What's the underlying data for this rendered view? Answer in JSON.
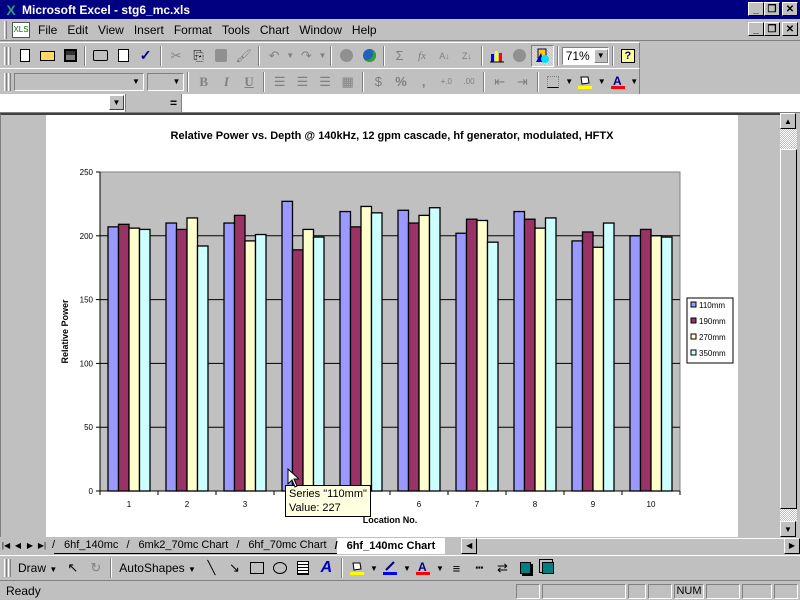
{
  "window": {
    "app_title": "Microsoft Excel - stg6_mc.xls",
    "controls": {
      "minimize": "_",
      "restore": "❐",
      "close": "✕"
    }
  },
  "menu": {
    "items": [
      {
        "label": "File",
        "accel": "F"
      },
      {
        "label": "Edit",
        "accel": "E"
      },
      {
        "label": "View",
        "accel": "V"
      },
      {
        "label": "Insert",
        "accel": "I"
      },
      {
        "label": "Format",
        "accel": "o"
      },
      {
        "label": "Tools",
        "accel": "T"
      },
      {
        "label": "Chart",
        "accel": "C"
      },
      {
        "label": "Window",
        "accel": "W"
      },
      {
        "label": "Help",
        "accel": "H"
      }
    ]
  },
  "standard_toolbar": {
    "buttons": [
      {
        "name": "new",
        "glyph": "🗋"
      },
      {
        "name": "open",
        "glyph": "📂"
      },
      {
        "name": "save",
        "glyph": "💾"
      },
      {
        "name": "print",
        "glyph": "🖶"
      },
      {
        "name": "print-preview",
        "glyph": "🔍"
      },
      {
        "name": "spelling",
        "glyph": "✓"
      },
      {
        "name": "cut",
        "glyph": "✂"
      },
      {
        "name": "copy",
        "glyph": "⎘"
      },
      {
        "name": "paste",
        "glyph": "📋"
      },
      {
        "name": "format-painter",
        "glyph": "🖌"
      },
      {
        "name": "undo",
        "glyph": "↶"
      },
      {
        "name": "redo",
        "glyph": "↷"
      },
      {
        "name": "hyperlink",
        "glyph": "🔗"
      },
      {
        "name": "web-toolbar",
        "glyph": "🌐"
      },
      {
        "name": "autosum",
        "glyph": "Σ"
      },
      {
        "name": "paste-function",
        "glyph": "fx"
      },
      {
        "name": "sort-ascending",
        "glyph": "A↓"
      },
      {
        "name": "sort-descending",
        "glyph": "Z↓"
      },
      {
        "name": "chart-wizard",
        "glyph": "📊"
      },
      {
        "name": "map",
        "glyph": "🗺"
      },
      {
        "name": "drawing",
        "glyph": "✎"
      },
      {
        "name": "help",
        "glyph": "?"
      }
    ],
    "zoom": "71%"
  },
  "formatting_toolbar": {
    "font": "",
    "size": "",
    "bold": "B",
    "italic": "I",
    "underline": "U",
    "percent": "%",
    "comma": ",",
    "increase_decimal": "+.0",
    "decrease_decimal": ".00",
    "font_color_accent": "#ff0000",
    "fill_color_accent": "#ffff00"
  },
  "formula_bar": {
    "name_box": "",
    "equals": "=",
    "content": ""
  },
  "chart_data": {
    "type": "bar",
    "title": "Relative Power vs. Depth @ 140kHz, 12 gpm cascade, hf generator, modulated, HFTX",
    "xlabel": "Location No.",
    "ylabel": "Relative Power",
    "ylim": [
      0,
      250
    ],
    "yticks": [
      0,
      50,
      100,
      150,
      200,
      250
    ],
    "grid": true,
    "legend_position": "right",
    "categories": [
      "1",
      "2",
      "3",
      "4",
      "5",
      "6",
      "7",
      "8",
      "9",
      "10"
    ],
    "series": [
      {
        "name": "110mm",
        "color": "#9999ff",
        "values": [
          207,
          210,
          210,
          227,
          219,
          220,
          202,
          219,
          196,
          200
        ]
      },
      {
        "name": "190mm",
        "color": "#993366",
        "values": [
          209,
          205,
          216,
          189,
          207,
          210,
          213,
          213,
          203,
          205
        ]
      },
      {
        "name": "270mm",
        "color": "#ffffcc",
        "values": [
          206,
          214,
          196,
          205,
          223,
          216,
          212,
          206,
          191,
          200
        ]
      },
      {
        "name": "350mm",
        "color": "#ccffff",
        "values": [
          205,
          192,
          201,
          199,
          218,
          222,
          195,
          214,
          210,
          199
        ]
      }
    ],
    "plot_background": "#c0c0c0"
  },
  "tooltip": {
    "line1": "Series \"110mm\"",
    "line2": "Value: 227"
  },
  "sheet_tabs": {
    "tabs": [
      {
        "label": "6hf_140mc",
        "active": false
      },
      {
        "label": "6mk2_70mc Chart",
        "active": false
      },
      {
        "label": "6hf_70mc Chart",
        "active": false
      },
      {
        "label": "6hf_140mc Chart",
        "active": true
      }
    ]
  },
  "draw_toolbar": {
    "draw": "Draw",
    "autoshapes": "AutoShapes"
  },
  "status": {
    "text": "Ready",
    "num": "NUM"
  }
}
